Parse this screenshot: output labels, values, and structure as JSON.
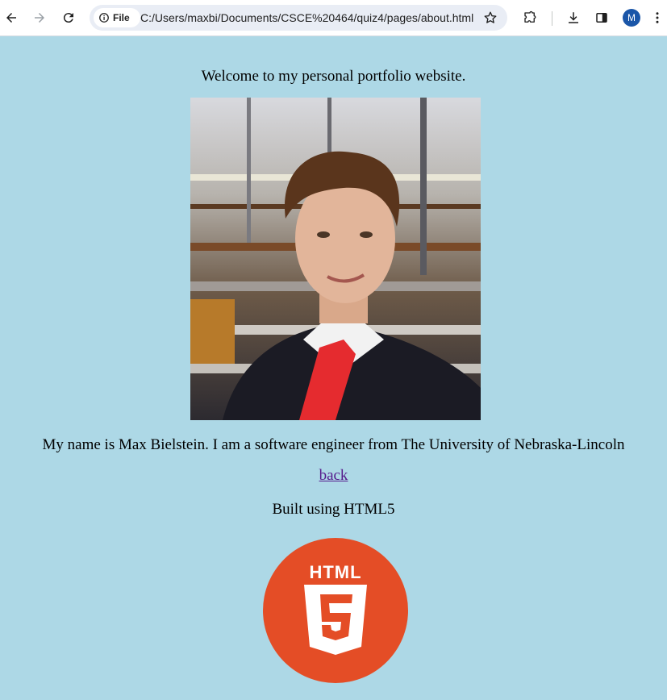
{
  "browser": {
    "file_label": "File",
    "url": "C:/Users/maxbi/Documents/CSCE%20464/quiz4/pages/about.html",
    "profile_initial": "M",
    "icons": [
      "back-arrow-icon",
      "forward-arrow-icon",
      "reload-icon",
      "info-icon",
      "star-icon",
      "extensions-icon",
      "download-icon",
      "side-panel-icon",
      "menu-dots-icon"
    ]
  },
  "page": {
    "welcome": "Welcome to my personal portfolio website.",
    "intro": "My name is Max Bielstein. I am a software engineer from The University of Nebraska-Lincoln",
    "back_link": "back",
    "built_with": "Built using HTML5",
    "logo_text": "HTML",
    "logo_digit": "5"
  },
  "colors": {
    "background": "#add8e6",
    "link": "#551a8b",
    "html5_orange": "#e44d26"
  }
}
